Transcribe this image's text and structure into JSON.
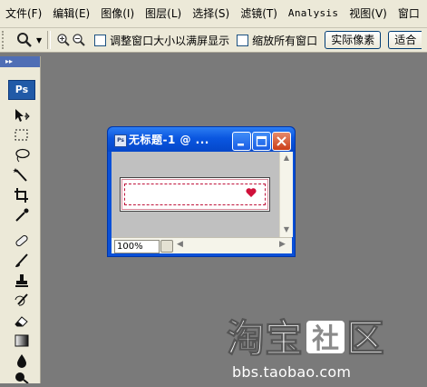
{
  "menubar": {
    "items": [
      {
        "label": "文件(F)"
      },
      {
        "label": "编辑(E)"
      },
      {
        "label": "图像(I)"
      },
      {
        "label": "图层(L)"
      },
      {
        "label": "选择(S)"
      },
      {
        "label": "滤镜(T)"
      },
      {
        "label": "Analysis"
      },
      {
        "label": "视图(V)"
      },
      {
        "label": "窗口"
      }
    ]
  },
  "options": {
    "resize_windows_label": "调整窗口大小以满屏显示",
    "zoom_all_windows_label": "缩放所有窗口",
    "actual_pixels_label": "实际像素",
    "fit_screen_label": "适合"
  },
  "toolbox": {
    "logo": "Ps",
    "tools": [
      "move-icon",
      "marquee-icon",
      "lasso-icon",
      "magic-wand-icon",
      "crop-icon",
      "eyedropper-icon",
      "healing-brush-icon",
      "brush-icon",
      "clone-stamp-icon",
      "history-brush-icon",
      "eraser-icon",
      "gradient-icon",
      "blur-icon",
      "dodge-icon"
    ]
  },
  "document": {
    "title": "无标题-1 @ ...",
    "icon_label": "Ps",
    "zoom": "100%"
  },
  "watermark": {
    "logo_text": "淘宝社区",
    "url": "bbs.taobao.com"
  },
  "colors": {
    "title_bar": "#0a56e0",
    "close_button": "#cc3d18",
    "workspace": "#7a7a7a",
    "frame_dashes": "#c0143c",
    "heart": "#d0103a"
  }
}
